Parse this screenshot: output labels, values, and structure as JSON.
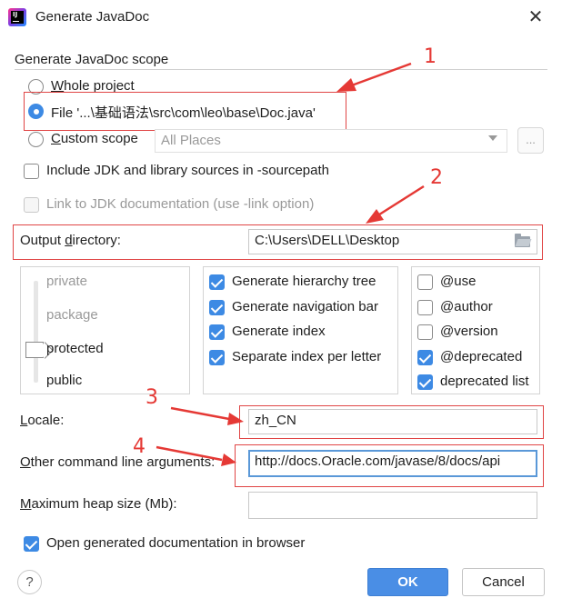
{
  "window": {
    "title": "Generate JavaDoc",
    "app_icon": "intellij-idea-icon",
    "close_icon": "close-icon"
  },
  "scope": {
    "section_label": "Generate JavaDoc scope",
    "whole_project": "Whole project",
    "file": "File '...\\基础语法\\src\\com\\leo\\base\\Doc.java'",
    "custom_scope": "Custom scope",
    "custom_scope_value": "All Places",
    "ellipsis": "...",
    "selected": "file"
  },
  "include_jdk": {
    "label": "Include JDK and library sources in -sourcepath",
    "checked": false
  },
  "link_jdk": {
    "label": "Link to JDK documentation (use -link option)",
    "checked": false,
    "enabled": false
  },
  "output": {
    "label": "Output directory:",
    "value": "C:\\Users\\DELL\\Desktop",
    "browse_icon": "folder-icon"
  },
  "visibility": {
    "levels": [
      "private",
      "package",
      "protected",
      "public"
    ],
    "selected": "protected"
  },
  "options_middle": [
    {
      "label": "Generate hierarchy tree",
      "checked": true
    },
    {
      "label": "Generate navigation bar",
      "checked": true
    },
    {
      "label": "Generate index",
      "checked": true
    },
    {
      "label": "Separate index per letter",
      "checked": true
    }
  ],
  "options_right": [
    {
      "label": "@use",
      "checked": false
    },
    {
      "label": "@author",
      "checked": false
    },
    {
      "label": "@version",
      "checked": false
    },
    {
      "label": "@deprecated",
      "checked": true
    },
    {
      "label": "deprecated list",
      "checked": true
    }
  ],
  "locale": {
    "label": "Locale:",
    "value": "zh_CN"
  },
  "other_args": {
    "label": "Other command line arguments:",
    "value": "http://docs.Oracle.com/javase/8/docs/api"
  },
  "max_heap": {
    "label": "Maximum heap size (Mb):",
    "value": ""
  },
  "open_browser": {
    "label": "Open generated documentation in browser",
    "checked": true
  },
  "buttons": {
    "help": "?",
    "ok": "OK",
    "cancel": "Cancel"
  },
  "annotations": {
    "color": "#e53935",
    "numbers": [
      "1",
      "2",
      "3",
      "4"
    ]
  },
  "colors": {
    "accent": "#3d8ae4",
    "ok_button": "#4a8ee5",
    "annotation_red": "#e53935"
  }
}
